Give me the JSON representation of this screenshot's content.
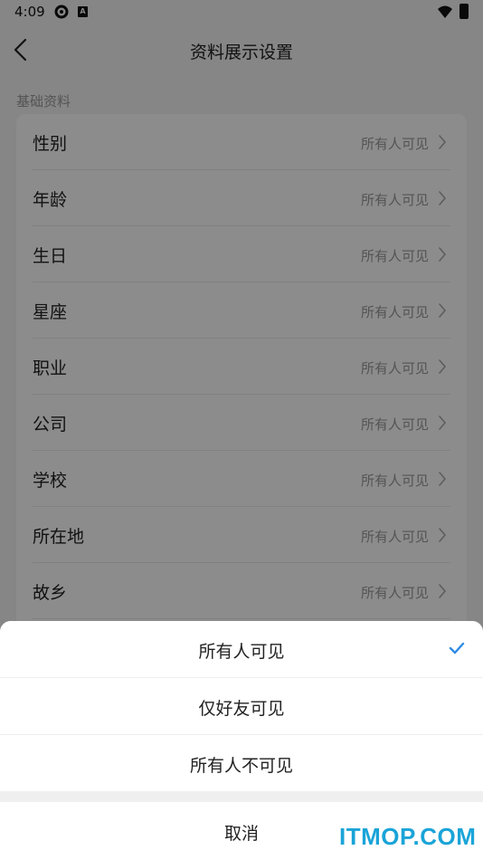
{
  "status_bar": {
    "time": "4:09"
  },
  "nav": {
    "title": "资料展示设置"
  },
  "section": {
    "label": "基础资料"
  },
  "rows": [
    {
      "label": "性别",
      "value": "所有人可见"
    },
    {
      "label": "年龄",
      "value": "所有人可见"
    },
    {
      "label": "生日",
      "value": "所有人可见"
    },
    {
      "label": "星座",
      "value": "所有人可见"
    },
    {
      "label": "职业",
      "value": "所有人可见"
    },
    {
      "label": "公司",
      "value": "所有人可见"
    },
    {
      "label": "学校",
      "value": "所有人可见"
    },
    {
      "label": "所在地",
      "value": "所有人可见"
    },
    {
      "label": "故乡",
      "value": "所有人可见"
    }
  ],
  "sheet": {
    "options": [
      {
        "label": "所有人可见",
        "selected": true
      },
      {
        "label": "仅好友可见",
        "selected": false
      },
      {
        "label": "所有人不可见",
        "selected": false
      }
    ],
    "cancel_label": "取消"
  },
  "watermark": "ITMOP.COM",
  "colors": {
    "accent": "#2f8de4",
    "watermark": "#1aa4d8",
    "overlay": "rgba(0,0,0,0.45)"
  }
}
